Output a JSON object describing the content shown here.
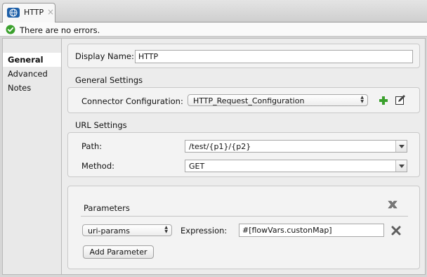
{
  "tab": {
    "title": "HTTP",
    "icon": "globe-icon",
    "close": "×"
  },
  "status": {
    "message": "There are no errors.",
    "icon": "check-circle-icon",
    "color": "#3aa02c"
  },
  "sidebar": {
    "items": [
      {
        "label": "General",
        "active": true
      },
      {
        "label": "Advanced",
        "active": false
      },
      {
        "label": "Notes",
        "active": false
      }
    ]
  },
  "general": {
    "display_name": {
      "label": "Display Name:",
      "value": "HTTP"
    },
    "settings_group": "General Settings",
    "connector_config": {
      "label": "Connector Configuration:",
      "value": "HTTP_Request_Configuration"
    },
    "url_group": "URL Settings",
    "path": {
      "label": "Path:",
      "value": "/test/{p1}/{p2}"
    },
    "method": {
      "label": "Method:",
      "value": "GET"
    },
    "parameters": {
      "title": "Parameters",
      "type": "uri-params",
      "expression_label": "Expression:",
      "expression_value": "#[flowVars.custonMap]",
      "add_button": "Add Parameter"
    }
  },
  "colors": {
    "accent_green": "#3aa02c",
    "remove_gray": "#6b6b6b"
  }
}
